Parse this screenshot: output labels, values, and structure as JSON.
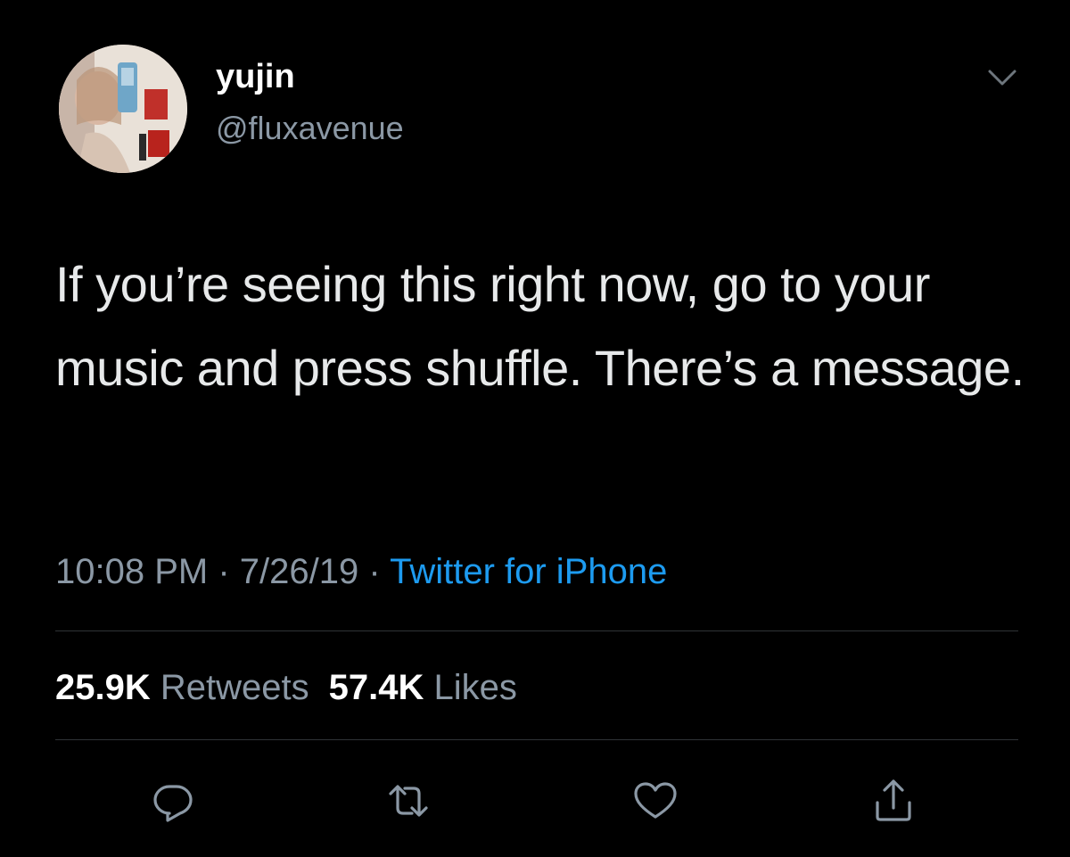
{
  "tweet": {
    "author": {
      "display_name": "yujin",
      "handle": "@fluxavenue"
    },
    "text": "If you’re seeing this right now, go to your music and press shuffle. There’s a message.",
    "time": "10:08 PM",
    "date": "7/26/19",
    "separator": "·",
    "source": "Twitter for iPhone",
    "stats": {
      "retweets_count": "25.9K",
      "retweets_label": "Retweets",
      "likes_count": "57.4K",
      "likes_label": "Likes"
    },
    "actions": [
      {
        "name": "reply",
        "icon": "reply-icon"
      },
      {
        "name": "retweet",
        "icon": "retweet-icon"
      },
      {
        "name": "like",
        "icon": "heart-icon"
      },
      {
        "name": "share",
        "icon": "share-icon"
      }
    ]
  },
  "colors": {
    "background": "#000000",
    "primary_text": "#e7e9ea",
    "secondary_text": "#8b98a5",
    "link": "#1d9bf0",
    "divider": "#2f3336"
  }
}
